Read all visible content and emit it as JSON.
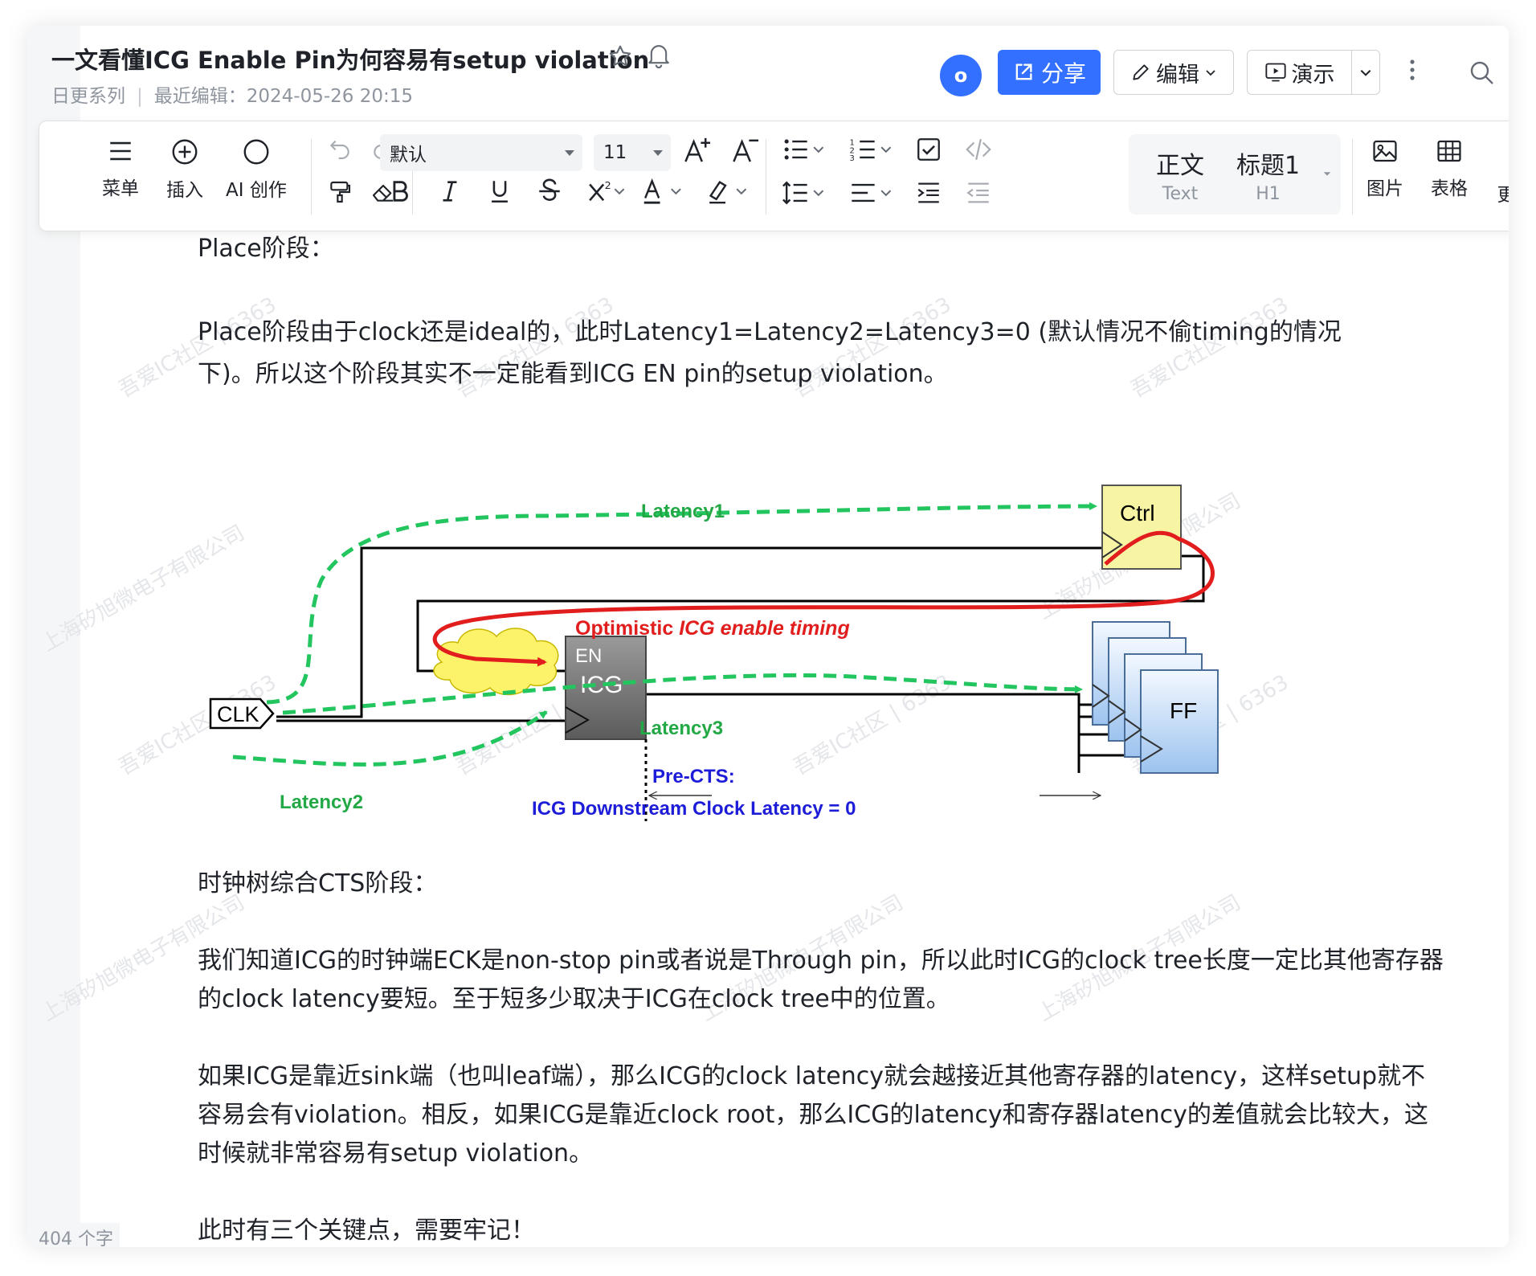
{
  "header": {
    "title": "一文看懂ICG Enable Pin为何容易有setup violation",
    "category": "日更系列",
    "last_edit": "最近编辑：2024-05-26 20:15",
    "avatar_initial": "o",
    "share_label": "分享",
    "edit_label": "编辑",
    "present_label": "演示"
  },
  "toolbar": {
    "menu_label": "菜单",
    "insert_label": "插入",
    "ai_label": "AI 创作",
    "font_value": "默认",
    "size_value": "11",
    "style_body": "正文",
    "style_body_sub": "Text",
    "style_h1": "标题1",
    "style_h1_sub": "H1",
    "image_label": "图片",
    "table_label": "表格",
    "more_label": "更"
  },
  "content": {
    "p1": "Place阶段：",
    "p2a": "Place阶段由于clock还是ideal的，此时Latency1=Latency2=Latency3=0 (默认情况不偷timing的情况",
    "p2b": "下)。所以这个阶段其实不一定能看到ICG EN pin的setup violation。",
    "p3": "时钟树综合CTS阶段：",
    "p4a": "我们知道ICG的时钟端ECK是non-stop pin或者说是Through pin，所以此时ICG的clock tree长度一定比其他寄存器",
    "p4b": "的clock latency要短。至于短多少取决于ICG在clock tree中的位置。",
    "p5a": "如果ICG是靠近sink端（也叫leaf端），那么ICG的clock latency就会越接近其他寄存器的latency，这样setup就不",
    "p5b": "容易会有violation。相反，如果ICG是靠近clock root，那么ICG的latency和寄存器latency的差值就会比较大，这",
    "p5c": "时候就非常容易有setup violation。",
    "p6": "此时有三个关键点，需要牢记！"
  },
  "diagram": {
    "latency1": "Latency1",
    "latency2": "Latency2",
    "latency3": "Latency3",
    "ctrl": "Ctrl",
    "clk": "CLK",
    "en": "EN",
    "icg": "ICG",
    "ff": "FF",
    "optimistic_a": "Optimistic ",
    "optimistic_b": "ICG enable timing",
    "prects": "Pre-CTS:",
    "downstream": "ICG Downstream Clock Latency = 0"
  },
  "footer": {
    "word_count": "404 个字"
  },
  "watermark": {
    "a": "吾爱IC社区 | 6363",
    "b": "上海矽旭微电子有限公司"
  },
  "colors": {
    "accent": "#3370ff",
    "green_path": "#22c55e",
    "red_path": "#e11d1d",
    "blue_text": "#1d1dd9"
  }
}
